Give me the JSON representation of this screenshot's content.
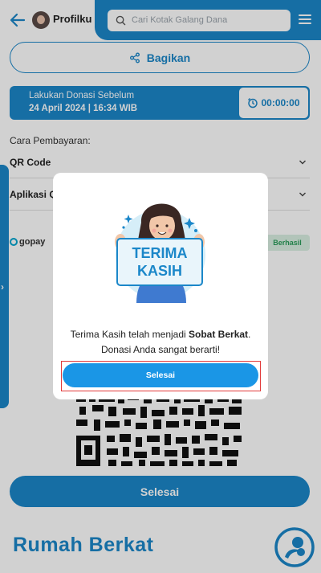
{
  "header": {
    "profile_label": "Profilku",
    "search_placeholder": "Cari Kotak Galang Dana"
  },
  "share": {
    "label": "Bagikan"
  },
  "deadline": {
    "line1": "Lakukan Donasi Sebelum",
    "line2": "24 April 2024 | 16:34 WIB",
    "timer": "00:00:00"
  },
  "payment": {
    "label": "Cara Pembayaran:",
    "options": [
      {
        "label": "QR Code"
      },
      {
        "label": "Aplikasi Q"
      }
    ],
    "method": "gopay",
    "status": "Berhasil"
  },
  "main_button": {
    "label": "Selesai"
  },
  "footer": {
    "logo_text": "Rumah Berkat"
  },
  "modal": {
    "banner_line1": "TERIMA",
    "banner_line2": "KASIH",
    "message_part1": "Terima Kasih telah menjadi ",
    "message_bold": "Sobat Berkat",
    "message_part2": ".",
    "message_line2": "Donasi Anda sangat berarti!",
    "button_label": "Selesai"
  },
  "colors": {
    "primary": "#1b87c9",
    "modal_button": "#1a96e6",
    "highlight_border": "#e23a3a",
    "success_bg": "#d9f0e2",
    "success_text": "#2a9d59"
  }
}
